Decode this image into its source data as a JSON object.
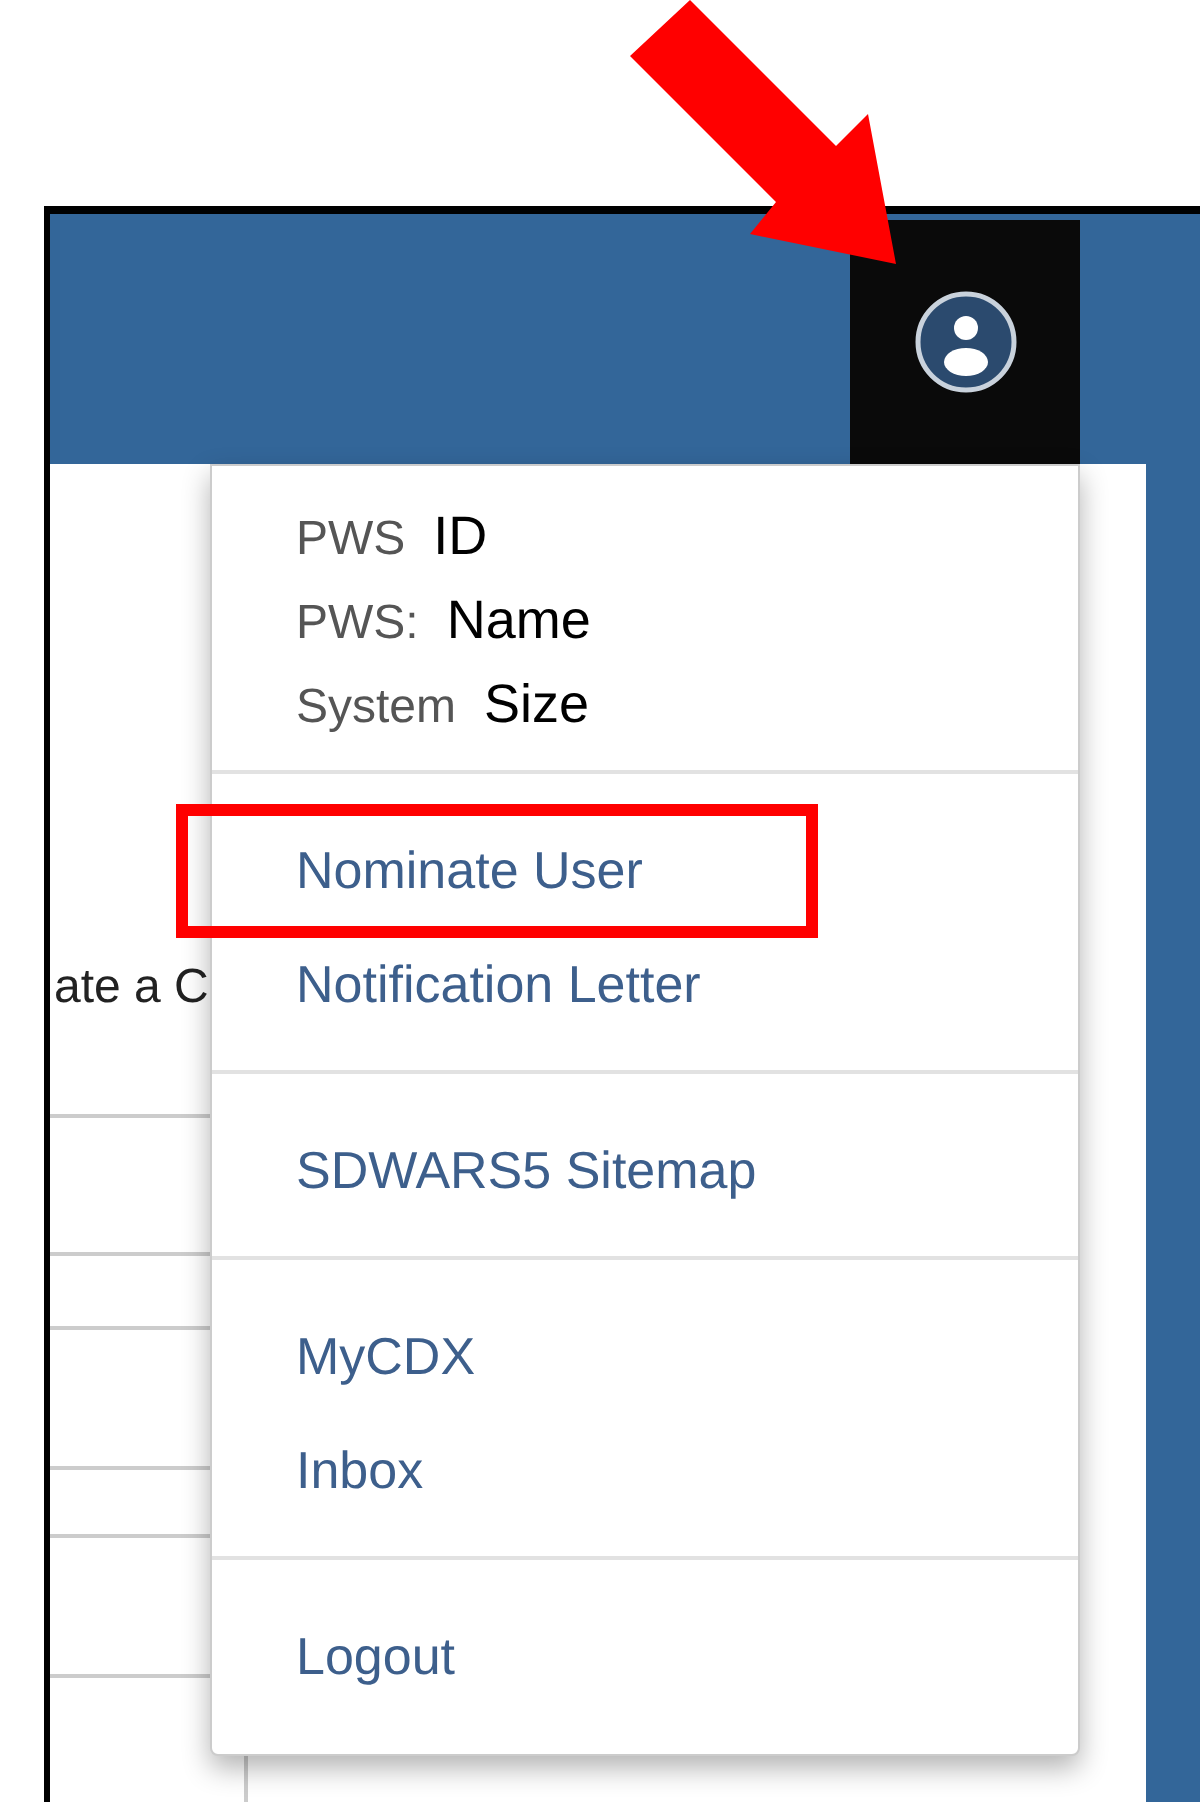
{
  "page_text": "ate a C",
  "user_menu": {
    "info": [
      {
        "label": "PWS",
        "value": "ID"
      },
      {
        "label": "PWS:",
        "value": "Name"
      },
      {
        "label": "System",
        "value": "Size"
      }
    ],
    "groups": [
      {
        "items": [
          {
            "label": "Nominate User",
            "highlighted": true
          },
          {
            "label": "Notification Letter",
            "highlighted": false
          }
        ]
      },
      {
        "items": [
          {
            "label": "SDWARS5 Sitemap",
            "highlighted": false
          }
        ]
      },
      {
        "items": [
          {
            "label": "MyCDX",
            "highlighted": false
          },
          {
            "label": "Inbox",
            "highlighted": false
          }
        ]
      },
      {
        "items": [
          {
            "label": "Logout",
            "highlighted": false
          }
        ]
      }
    ]
  }
}
